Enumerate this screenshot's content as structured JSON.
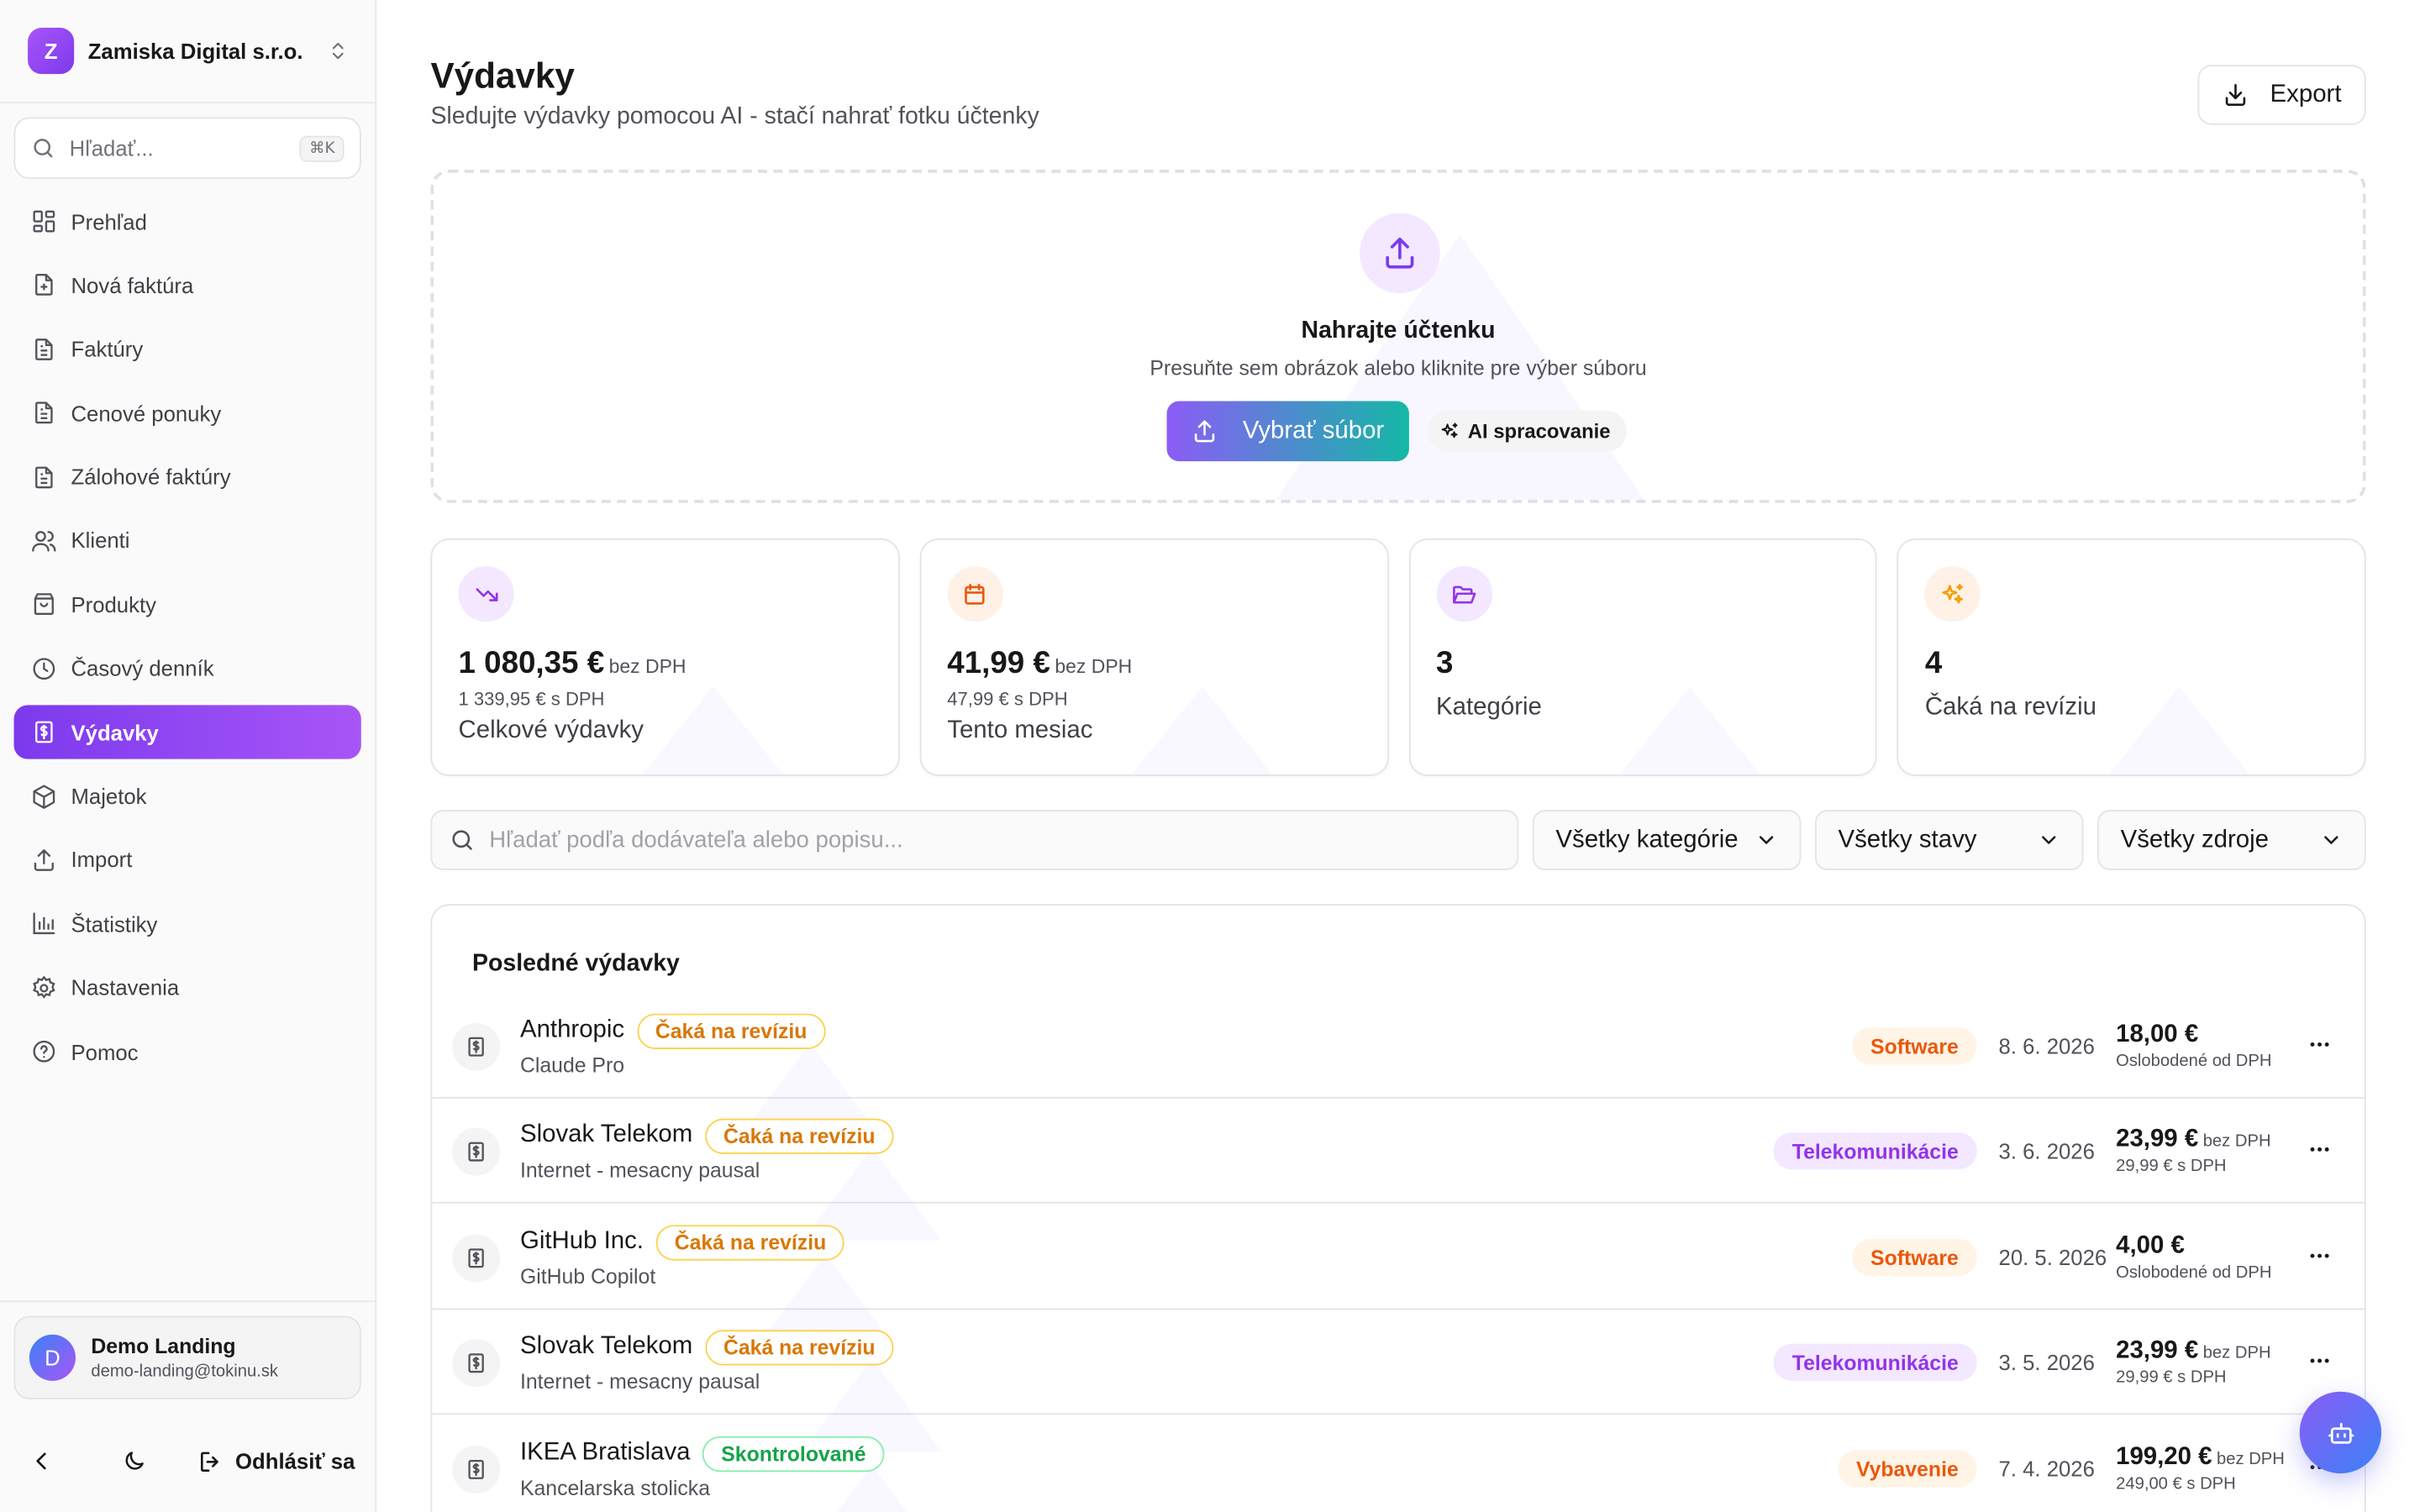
{
  "org": {
    "initial": "Z",
    "name": "Zamiska Digital s.r.o."
  },
  "search": {
    "placeholder": "Hľadať...",
    "shortcut": "⌘K"
  },
  "nav": [
    {
      "label": "Prehľad",
      "icon": "dashboard-icon"
    },
    {
      "label": "Nová faktúra",
      "icon": "file-plus-icon"
    },
    {
      "label": "Faktúry",
      "icon": "file-text-icon"
    },
    {
      "label": "Cenové ponuky",
      "icon": "file-text-icon"
    },
    {
      "label": "Zálohové faktúry",
      "icon": "file-text-icon"
    },
    {
      "label": "Klienti",
      "icon": "users-icon"
    },
    {
      "label": "Produkty",
      "icon": "package-icon"
    },
    {
      "label": "Časový denník",
      "icon": "clock-icon"
    },
    {
      "label": "Výdavky",
      "icon": "receipt-icon",
      "active": true
    },
    {
      "label": "Majetok",
      "icon": "box-icon"
    },
    {
      "label": "Import",
      "icon": "upload-icon"
    },
    {
      "label": "Štatistiky",
      "icon": "bar-chart-icon"
    },
    {
      "label": "Nastavenia",
      "icon": "gear-icon"
    },
    {
      "label": "Pomoc",
      "icon": "help-circle-icon"
    }
  ],
  "user": {
    "initial": "D",
    "name": "Demo Landing",
    "email": "demo-landing@tokinu.sk"
  },
  "footer": {
    "logout_label": "Odhlásiť sa"
  },
  "header": {
    "title": "Výdavky",
    "subtitle": "Sledujte výdavky pomocou AI - stačí nahrať fotku účtenky",
    "export_label": "Export"
  },
  "upload": {
    "title": "Nahrajte účtenku",
    "hint": "Presuňte sem obrázok alebo kliknite pre výber súboru",
    "button_label": "Vybrať súbor",
    "ai_label": "AI spracovanie"
  },
  "stats": [
    {
      "value": "1 080,35 €",
      "suffix": "bez DPH",
      "sub": "1 339,95 € s DPH",
      "label": "Celkové výdavky",
      "icon": "trending-down-icon"
    },
    {
      "value": "41,99 €",
      "suffix": "bez DPH",
      "sub": "47,99 € s DPH",
      "label": "Tento mesiac",
      "icon": "calendar-icon"
    },
    {
      "value": "3",
      "suffix": "",
      "sub": "",
      "label": "Kategórie",
      "icon": "folder-open-icon"
    },
    {
      "value": "4",
      "suffix": "",
      "sub": "",
      "label": "Čaká na revíziu",
      "icon": "sparkles-icon"
    }
  ],
  "filters": {
    "search_placeholder": "Hľadať podľa dodávateľa alebo popisu...",
    "category": "Všetky kategórie",
    "status": "Všetky stavy",
    "source": "Všetky zdroje"
  },
  "list": {
    "title": "Posledné výdavky",
    "rows": [
      {
        "vendor": "Anthropic",
        "status": "Čaká na revíziu",
        "status_type": "pending",
        "description": "Claude Pro",
        "category": "Software",
        "category_color": "orange",
        "date": "8. 6. 2026",
        "amount": "18,00 €",
        "amount_suffix": "",
        "amount_sub": "Oslobodené od DPH"
      },
      {
        "vendor": "Slovak Telekom",
        "status": "Čaká na revíziu",
        "status_type": "pending",
        "description": "Internet - mesacny pausal",
        "category": "Telekomunikácie",
        "category_color": "purple",
        "date": "3. 6. 2026",
        "amount": "23,99 €",
        "amount_suffix": "bez DPH",
        "amount_sub": "29,99 € s DPH"
      },
      {
        "vendor": "GitHub Inc.",
        "status": "Čaká na revíziu",
        "status_type": "pending",
        "description": "GitHub Copilot",
        "category": "Software",
        "category_color": "orange",
        "date": "20. 5. 2026",
        "amount": "4,00 €",
        "amount_suffix": "",
        "amount_sub": "Oslobodené od DPH"
      },
      {
        "vendor": "Slovak Telekom",
        "status": "Čaká na revíziu",
        "status_type": "pending",
        "description": "Internet - mesacny pausal",
        "category": "Telekomunikácie",
        "category_color": "purple",
        "date": "3. 5. 2026",
        "amount": "23,99 €",
        "amount_suffix": "bez DPH",
        "amount_sub": "29,99 € s DPH"
      },
      {
        "vendor": "IKEA Bratislava",
        "status": "Skontrolované",
        "status_type": "done",
        "description": "Kancelarska stolicka",
        "category": "Vybavenie",
        "category_color": "orange",
        "date": "7. 4. 2026",
        "amount": "199,20 €",
        "amount_suffix": "bez DPH",
        "amount_sub": "249,00 € s DPH"
      }
    ]
  }
}
